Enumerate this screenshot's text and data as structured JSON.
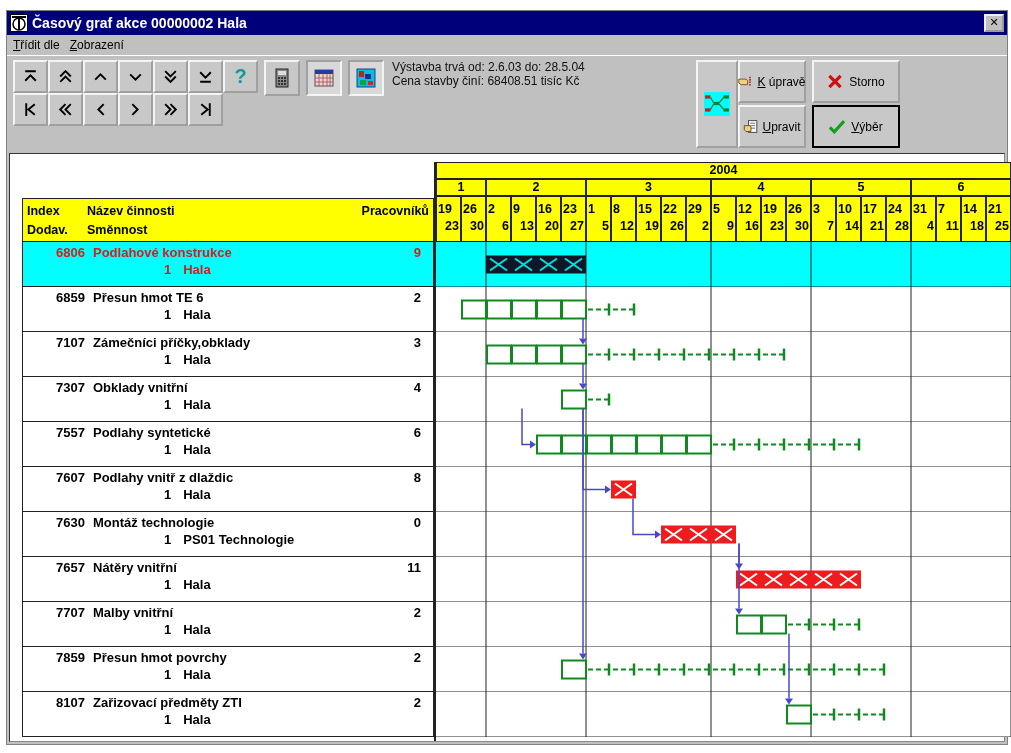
{
  "window": {
    "title": "Časový graf akce 00000002 Hala",
    "close": "✕"
  },
  "menu": [
    {
      "key": "T",
      "rest": "řídit dle"
    },
    {
      "key": "Z",
      "rest": "obrazení"
    }
  ],
  "toolbar": {
    "nav_top": [
      {
        "kind": "top"
      },
      {
        "kind": "up2"
      },
      {
        "kind": "up"
      },
      {
        "kind": "down"
      },
      {
        "kind": "down2"
      },
      {
        "kind": "bottom"
      }
    ],
    "nav_bottom": [
      {
        "kind": "first"
      },
      {
        "kind": "left2"
      },
      {
        "kind": "left"
      },
      {
        "kind": "right"
      },
      {
        "kind": "right2"
      },
      {
        "kind": "last"
      }
    ],
    "help": {
      "label": "?",
      "disabled": true
    },
    "tools": [
      {
        "kind": "calculator",
        "pressed": false
      },
      {
        "kind": "calendar",
        "pressed": true
      },
      {
        "kind": "chart",
        "pressed": true
      }
    ],
    "info": [
      "Výstavba trvá  od: 2.6.03 do: 28.5.04",
      "Cena stavby činí: 68408.51 tisíc Kč"
    ],
    "actions": [
      {
        "key": "K",
        "rest": " úpravě",
        "kind": "hand"
      },
      {
        "key": "U",
        "rest": "pravit",
        "kind": "edit"
      }
    ],
    "dialog": [
      {
        "rest": "Storno",
        "kind": "cancel"
      },
      {
        "key": "V",
        "rest": "ýběr",
        "kind": "ok"
      }
    ]
  },
  "table": {
    "header": {
      "index": "Index",
      "index2": "Dodav.",
      "name": "Název  činnosti",
      "shift": "Směnnost",
      "workers": "Pracovníků"
    },
    "rows": [
      {
        "index": "6806",
        "name": "Podlahové konstrukce",
        "workers": "9",
        "shift": "1",
        "place": "Hala",
        "selected": true,
        "timeline": [
          {
            "kind": "none"
          },
          {
            "kind": "none"
          },
          {
            "kind": "selected"
          },
          {
            "kind": "selected"
          },
          {
            "kind": "selected"
          },
          {
            "kind": "selected"
          },
          {
            "kind": "none"
          },
          {
            "kind": "none"
          },
          {
            "kind": "none"
          },
          {
            "kind": "none"
          },
          {
            "kind": "none"
          },
          {
            "kind": "none"
          },
          {
            "kind": "none"
          },
          {
            "kind": "none"
          },
          {
            "kind": "none"
          },
          {
            "kind": "none"
          },
          {
            "kind": "none"
          },
          {
            "kind": "none"
          },
          {
            "kind": "none"
          },
          {
            "kind": "none"
          },
          {
            "kind": "none"
          },
          {
            "kind": "none"
          },
          {
            "kind": "none"
          }
        ]
      },
      {
        "index": "6859",
        "name": "Přesun hmot TE 6",
        "workers": "2",
        "shift": "1",
        "place": "Hala",
        "selected": false,
        "timeline": [
          {
            "kind": "none"
          },
          {
            "kind": "task"
          },
          {
            "kind": "task"
          },
          {
            "kind": "task"
          },
          {
            "kind": "task"
          },
          {
            "kind": "task"
          },
          {
            "kind": "float"
          },
          {
            "kind": "float"
          },
          {
            "kind": "none"
          },
          {
            "kind": "none"
          },
          {
            "kind": "none"
          },
          {
            "kind": "none"
          },
          {
            "kind": "none"
          },
          {
            "kind": "none"
          },
          {
            "kind": "none"
          },
          {
            "kind": "none"
          },
          {
            "kind": "none"
          },
          {
            "kind": "none"
          },
          {
            "kind": "none"
          },
          {
            "kind": "none"
          },
          {
            "kind": "none"
          },
          {
            "kind": "none"
          },
          {
            "kind": "none"
          }
        ]
      },
      {
        "index": "7107",
        "name": "Zámečníci příčky,obklady",
        "workers": "3",
        "shift": "1",
        "place": "Hala",
        "selected": false,
        "arrow": {
          "kind": "drop_end"
        },
        "timeline": [
          {
            "kind": "none"
          },
          {
            "kind": "none"
          },
          {
            "kind": "task"
          },
          {
            "kind": "task"
          },
          {
            "kind": "task"
          },
          {
            "kind": "task"
          },
          {
            "kind": "float"
          },
          {
            "kind": "float"
          },
          {
            "kind": "float"
          },
          {
            "kind": "float"
          },
          {
            "kind": "float"
          },
          {
            "kind": "float"
          },
          {
            "kind": "float"
          },
          {
            "kind": "float"
          },
          {
            "kind": "none"
          },
          {
            "kind": "none"
          },
          {
            "kind": "none"
          },
          {
            "kind": "none"
          },
          {
            "kind": "none"
          },
          {
            "kind": "none"
          },
          {
            "kind": "none"
          },
          {
            "kind": "none"
          },
          {
            "kind": "none"
          }
        ]
      },
      {
        "index": "7307",
        "name": "Obklady vnitřní",
        "workers": "4",
        "shift": "1",
        "place": "Hala",
        "selected": false,
        "arrow": {
          "kind": "drop_end"
        },
        "timeline": [
          {
            "kind": "none"
          },
          {
            "kind": "none"
          },
          {
            "kind": "none"
          },
          {
            "kind": "none"
          },
          {
            "kind": "none"
          },
          {
            "kind": "task"
          },
          {
            "kind": "float"
          },
          {
            "kind": "none"
          },
          {
            "kind": "none"
          },
          {
            "kind": "none"
          },
          {
            "kind": "none"
          },
          {
            "kind": "none"
          },
          {
            "kind": "none"
          },
          {
            "kind": "none"
          },
          {
            "kind": "none"
          },
          {
            "kind": "none"
          },
          {
            "kind": "none"
          },
          {
            "kind": "none"
          },
          {
            "kind": "none"
          },
          {
            "kind": "none"
          },
          {
            "kind": "none"
          },
          {
            "kind": "none"
          },
          {
            "kind": "none"
          }
        ]
      },
      {
        "index": "7557",
        "name": "Podlahy syntetické",
        "workers": "6",
        "shift": "1",
        "place": "Hala",
        "selected": false,
        "arrow": {
          "kind": "enter"
        },
        "timeline": [
          {
            "kind": "none"
          },
          {
            "kind": "none"
          },
          {
            "kind": "none"
          },
          {
            "kind": "none"
          },
          {
            "kind": "task"
          },
          {
            "kind": "task"
          },
          {
            "kind": "task"
          },
          {
            "kind": "task"
          },
          {
            "kind": "task"
          },
          {
            "kind": "task"
          },
          {
            "kind": "task"
          },
          {
            "kind": "float"
          },
          {
            "kind": "float"
          },
          {
            "kind": "float"
          },
          {
            "kind": "float"
          },
          {
            "kind": "float"
          },
          {
            "kind": "float"
          },
          {
            "kind": "none"
          },
          {
            "kind": "none"
          },
          {
            "kind": "none"
          },
          {
            "kind": "none"
          },
          {
            "kind": "none"
          },
          {
            "kind": "none"
          }
        ]
      },
      {
        "index": "7607",
        "name": "Podlahy vnitř z dlaždic",
        "workers": "8",
        "shift": "1",
        "place": "Hala",
        "selected": false,
        "arrow": {
          "kind": "enter"
        },
        "timeline": [
          {
            "kind": "none"
          },
          {
            "kind": "none"
          },
          {
            "kind": "none"
          },
          {
            "kind": "none"
          },
          {
            "kind": "none"
          },
          {
            "kind": "none"
          },
          {
            "kind": "none"
          },
          {
            "kind": "critical"
          },
          {
            "kind": "none"
          },
          {
            "kind": "none"
          },
          {
            "kind": "none"
          },
          {
            "kind": "none"
          },
          {
            "kind": "none"
          },
          {
            "kind": "none"
          },
          {
            "kind": "none"
          },
          {
            "kind": "none"
          },
          {
            "kind": "none"
          },
          {
            "kind": "none"
          },
          {
            "kind": "none"
          },
          {
            "kind": "none"
          },
          {
            "kind": "none"
          },
          {
            "kind": "none"
          },
          {
            "kind": "none"
          }
        ]
      },
      {
        "index": "7630",
        "name": "Montáž technologie",
        "workers": "0",
        "shift": "1",
        "place": "PS01 Technologie",
        "selected": false,
        "arrow": {
          "kind": "enter"
        },
        "timeline": [
          {
            "kind": "none"
          },
          {
            "kind": "none"
          },
          {
            "kind": "none"
          },
          {
            "kind": "none"
          },
          {
            "kind": "none"
          },
          {
            "kind": "none"
          },
          {
            "kind": "none"
          },
          {
            "kind": "none"
          },
          {
            "kind": "none"
          },
          {
            "kind": "critical"
          },
          {
            "kind": "critical"
          },
          {
            "kind": "critical"
          },
          {
            "kind": "none"
          },
          {
            "kind": "none"
          },
          {
            "kind": "none"
          },
          {
            "kind": "none"
          },
          {
            "kind": "none"
          },
          {
            "kind": "none"
          },
          {
            "kind": "none"
          },
          {
            "kind": "none"
          },
          {
            "kind": "none"
          },
          {
            "kind": "none"
          },
          {
            "kind": "none"
          }
        ]
      },
      {
        "index": "7657",
        "name": "Nátěry vnitřní",
        "workers": "11",
        "shift": "1",
        "place": "Hala",
        "selected": false,
        "arrow": {
          "kind": "drop_start"
        },
        "timeline": [
          {
            "kind": "none"
          },
          {
            "kind": "none"
          },
          {
            "kind": "none"
          },
          {
            "kind": "none"
          },
          {
            "kind": "none"
          },
          {
            "kind": "none"
          },
          {
            "kind": "none"
          },
          {
            "kind": "none"
          },
          {
            "kind": "none"
          },
          {
            "kind": "none"
          },
          {
            "kind": "none"
          },
          {
            "kind": "none"
          },
          {
            "kind": "critical"
          },
          {
            "kind": "critical"
          },
          {
            "kind": "critical"
          },
          {
            "kind": "critical"
          },
          {
            "kind": "critical"
          },
          {
            "kind": "none"
          },
          {
            "kind": "none"
          },
          {
            "kind": "none"
          },
          {
            "kind": "none"
          },
          {
            "kind": "none"
          },
          {
            "kind": "none"
          }
        ]
      },
      {
        "index": "7707",
        "name": "Malby vnitřní",
        "workers": "2",
        "shift": "1",
        "place": "Hala",
        "selected": false,
        "arrow": {
          "kind": "drop_start"
        },
        "timeline": [
          {
            "kind": "none"
          },
          {
            "kind": "none"
          },
          {
            "kind": "none"
          },
          {
            "kind": "none"
          },
          {
            "kind": "none"
          },
          {
            "kind": "none"
          },
          {
            "kind": "none"
          },
          {
            "kind": "none"
          },
          {
            "kind": "none"
          },
          {
            "kind": "none"
          },
          {
            "kind": "none"
          },
          {
            "kind": "none"
          },
          {
            "kind": "task"
          },
          {
            "kind": "task"
          },
          {
            "kind": "float"
          },
          {
            "kind": "float"
          },
          {
            "kind": "float"
          },
          {
            "kind": "none"
          },
          {
            "kind": "none"
          },
          {
            "kind": "none"
          },
          {
            "kind": "none"
          },
          {
            "kind": "none"
          },
          {
            "kind": "none"
          }
        ]
      },
      {
        "index": "7859",
        "name": "Přesun hmot povrchy",
        "workers": "2",
        "shift": "1",
        "place": "Hala",
        "selected": false,
        "arrow": {
          "kind": "drop_end"
        },
        "timeline": [
          {
            "kind": "none"
          },
          {
            "kind": "none"
          },
          {
            "kind": "none"
          },
          {
            "kind": "none"
          },
          {
            "kind": "none"
          },
          {
            "kind": "task"
          },
          {
            "kind": "float"
          },
          {
            "kind": "float"
          },
          {
            "kind": "float"
          },
          {
            "kind": "float"
          },
          {
            "kind": "float"
          },
          {
            "kind": "float"
          },
          {
            "kind": "float"
          },
          {
            "kind": "float"
          },
          {
            "kind": "float"
          },
          {
            "kind": "float"
          },
          {
            "kind": "float"
          },
          {
            "kind": "float"
          },
          {
            "kind": "none"
          },
          {
            "kind": "none"
          },
          {
            "kind": "none"
          },
          {
            "kind": "none"
          },
          {
            "kind": "none"
          }
        ]
      },
      {
        "index": "8107",
        "name": "Zařizovací předměty ZTI",
        "workers": "2",
        "shift": "1",
        "place": "Hala",
        "selected": false,
        "arrow": {
          "kind": "drop_start"
        },
        "timeline": [
          {
            "kind": "none"
          },
          {
            "kind": "none"
          },
          {
            "kind": "none"
          },
          {
            "kind": "none"
          },
          {
            "kind": "none"
          },
          {
            "kind": "none"
          },
          {
            "kind": "none"
          },
          {
            "kind": "none"
          },
          {
            "kind": "none"
          },
          {
            "kind": "none"
          },
          {
            "kind": "none"
          },
          {
            "kind": "none"
          },
          {
            "kind": "none"
          },
          {
            "kind": "none"
          },
          {
            "kind": "task"
          },
          {
            "kind": "float"
          },
          {
            "kind": "float"
          },
          {
            "kind": "float"
          },
          {
            "kind": "none"
          },
          {
            "kind": "none"
          },
          {
            "kind": "none"
          },
          {
            "kind": "none"
          },
          {
            "kind": "none"
          }
        ]
      }
    ]
  },
  "gantt": {
    "year": "2004",
    "months": [
      {
        "label": "1",
        "weeks": [
          {
            "days": [
              "19",
              "23"
            ]
          },
          {
            "days": [
              "26",
              "30"
            ]
          }
        ]
      },
      {
        "label": "2",
        "weeks": [
          {
            "days": [
              "2",
              "6"
            ]
          },
          {
            "days": [
              "9",
              "13"
            ]
          },
          {
            "days": [
              "16",
              "20"
            ]
          },
          {
            "days": [
              "23",
              "27"
            ]
          }
        ]
      },
      {
        "label": "3",
        "weeks": [
          {
            "days": [
              "1",
              "5"
            ]
          },
          {
            "days": [
              "8",
              "12"
            ]
          },
          {
            "days": [
              "15",
              "19"
            ]
          },
          {
            "days": [
              "22",
              "26"
            ]
          },
          {
            "days": [
              "29",
              "2"
            ]
          }
        ]
      },
      {
        "label": "4",
        "weeks": [
          {
            "days": [
              "5",
              "9"
            ]
          },
          {
            "days": [
              "12",
              "16"
            ]
          },
          {
            "days": [
              "19",
              "23"
            ]
          },
          {
            "days": [
              "26",
              "30"
            ]
          }
        ]
      },
      {
        "label": "5",
        "weeks": [
          {
            "days": [
              "3",
              "7"
            ]
          },
          {
            "days": [
              "10",
              "14"
            ]
          },
          {
            "days": [
              "17",
              "21"
            ]
          },
          {
            "days": [
              "24",
              "28"
            ]
          }
        ]
      },
      {
        "label": "6",
        "weeks": [
          {
            "days": [
              "31",
              "4"
            ]
          },
          {
            "days": [
              "7",
              "11"
            ]
          },
          {
            "days": [
              "14",
              "18"
            ]
          },
          {
            "days": [
              "21",
              "25"
            ]
          }
        ]
      }
    ]
  }
}
